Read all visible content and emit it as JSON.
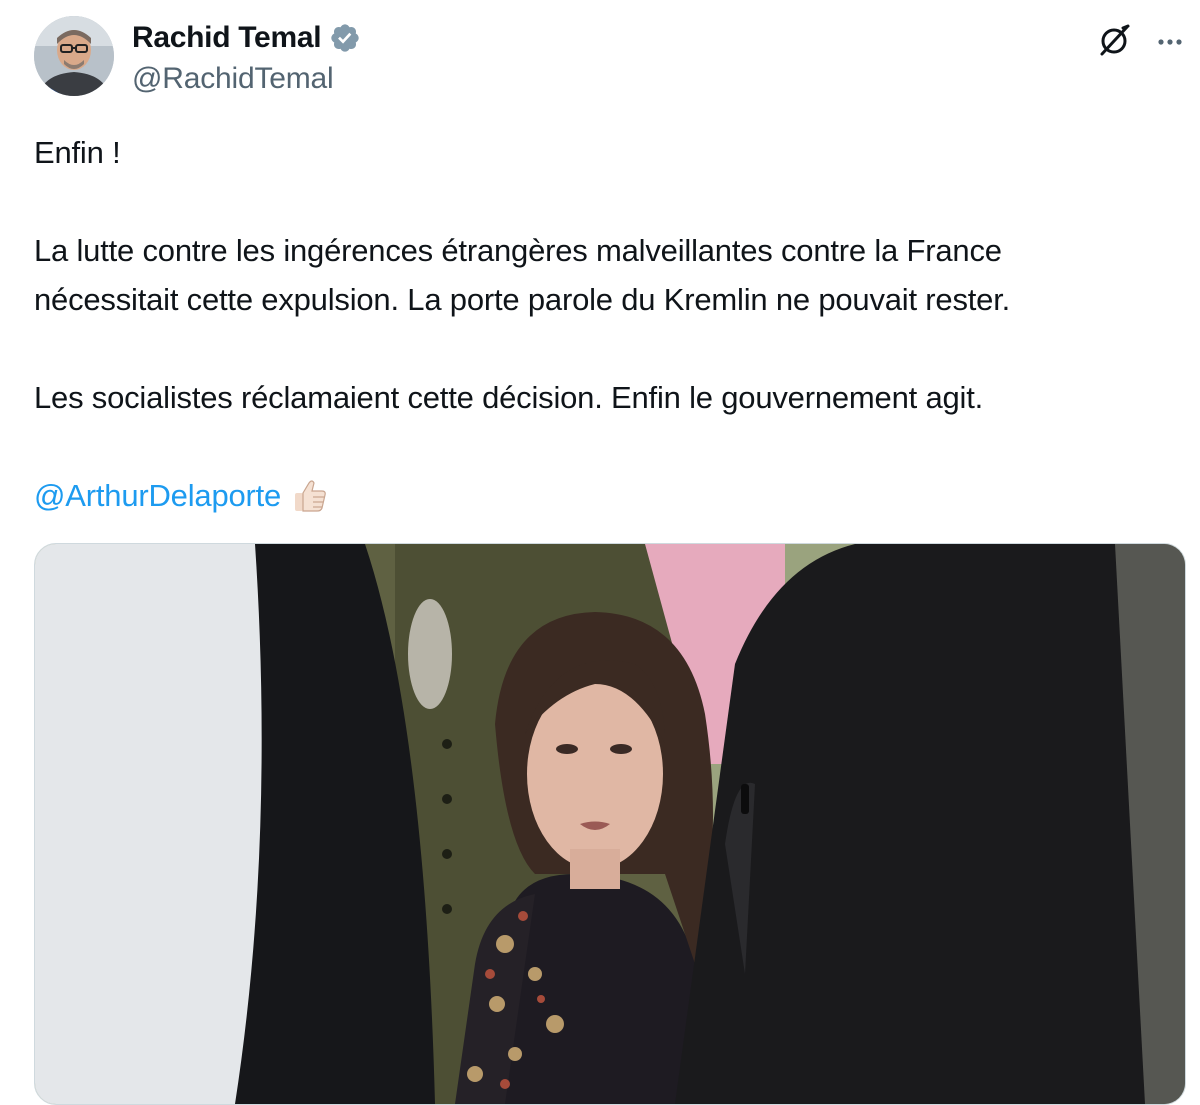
{
  "author": {
    "display_name": "Rachid Temal",
    "handle": "@RachidTemal",
    "verified_icon": "verified-badge-icon"
  },
  "actions": {
    "grok_icon": "grok-slash-icon",
    "more_icon": "more-options-icon"
  },
  "tweet": {
    "line1": "Enfin !",
    "paragraph2_line1": "La lutte contre les ingérences étrangères malveillantes contre la France",
    "paragraph2_line2": "nécessitait cette expulsion. La porte parole du Kremlin ne pouvait rester.",
    "paragraph3": "Les socialistes réclamaient cette décision. Enfin le gouvernement agit.",
    "mention": "@ArthurDelaporte",
    "emoji_icon": "thumbs-up-icon"
  },
  "colors": {
    "link": "#1d9bf0",
    "verified": "#829aab",
    "text": "#0f1419",
    "secondary": "#536471"
  }
}
